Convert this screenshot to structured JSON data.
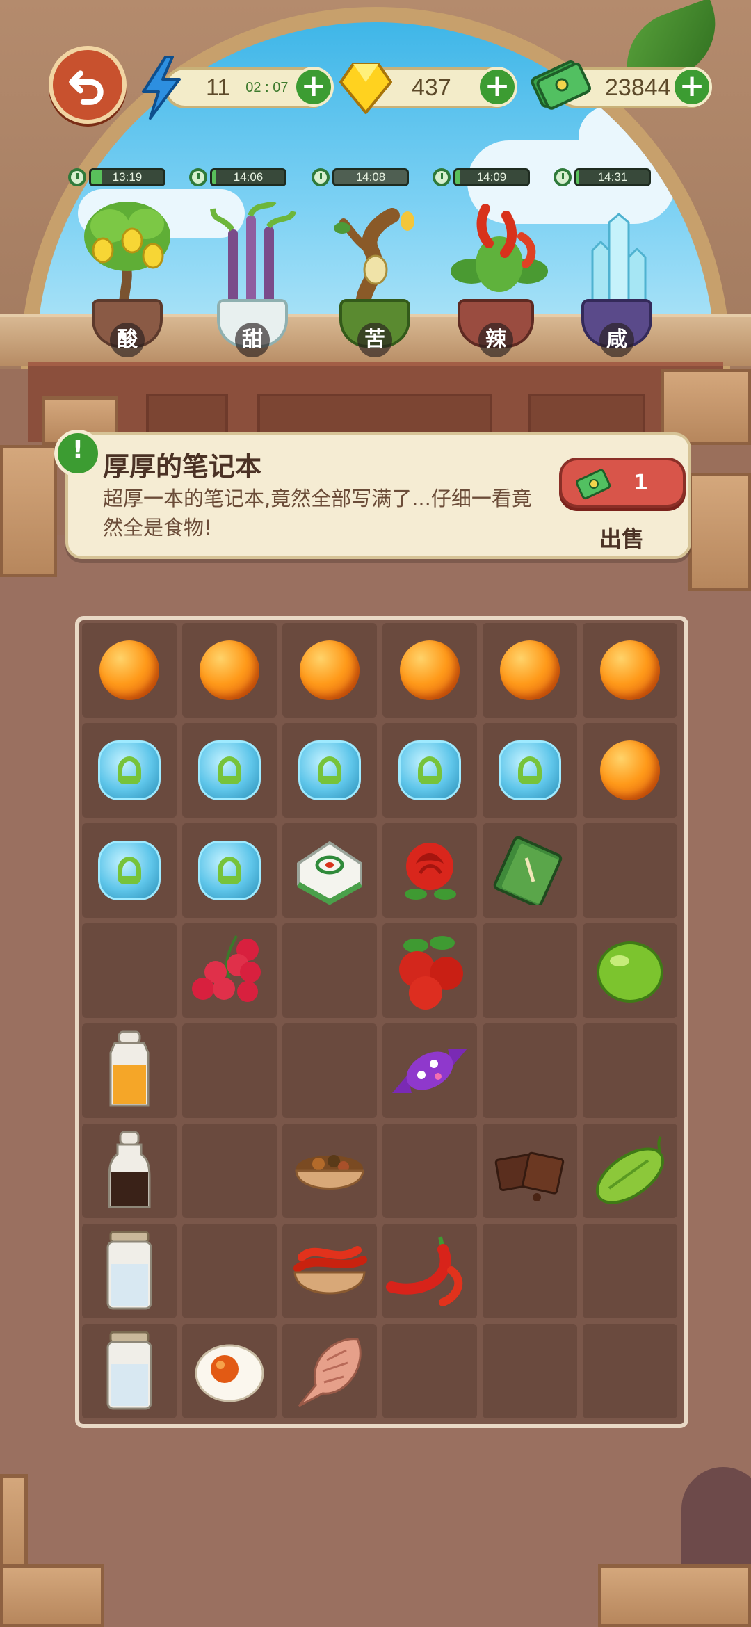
{
  "hud": {
    "energy": "11",
    "energy_timer": "02 : 07",
    "gems": "437",
    "cash": "23844",
    "plus": "+"
  },
  "plants": [
    {
      "timer": "13:19",
      "label": "酸",
      "icon": "lemon-tree-icon"
    },
    {
      "timer": "14:06",
      "label": "甜",
      "icon": "sugarcane-icon"
    },
    {
      "timer": "14:08",
      "label": "苦",
      "icon": "bitter-tree-icon"
    },
    {
      "timer": "14:09",
      "label": "辣",
      "icon": "chili-plant-icon"
    },
    {
      "timer": "14:31",
      "label": "咸",
      "icon": "salt-crystal-icon"
    }
  ],
  "info": {
    "badge": "!",
    "title": "厚厚的笔记本",
    "description": "超厚一本的笔记本,竟然全部写满了...仔细一看竟然全是食物!",
    "sell_price": "1",
    "sell_label": "出售"
  },
  "grid": {
    "rows": 8,
    "cols": 6,
    "items": [
      [
        "orange-orb",
        "orange-orb",
        "orange-orb",
        "orange-orb",
        "orange-orb",
        "orange-orb"
      ],
      [
        "blue-orb",
        "blue-orb",
        "blue-orb",
        "blue-orb",
        "blue-orb",
        "orange-orb"
      ],
      [
        "blue-orb",
        "blue-orb",
        "mahjong-tile",
        "rose",
        "notebook",
        ""
      ],
      [
        "",
        "lychee",
        "",
        "hawthorn",
        "",
        "lime"
      ],
      [
        "honey-jar",
        "",
        "",
        "candy",
        "",
        ""
      ],
      [
        "soy-sauce-bottle",
        "",
        "spice-bowl",
        "",
        "chocolate",
        "bitter-melon"
      ],
      [
        "salt-jar",
        "",
        "chili-bowl",
        "red-chili",
        "",
        ""
      ],
      [
        "salt-jar",
        "salted-egg",
        "dried-fish",
        "",
        "",
        ""
      ]
    ]
  },
  "colors": {
    "accent_green": "#3c9c32",
    "sell_red": "#d8554a",
    "back_orange": "#c8512e"
  }
}
